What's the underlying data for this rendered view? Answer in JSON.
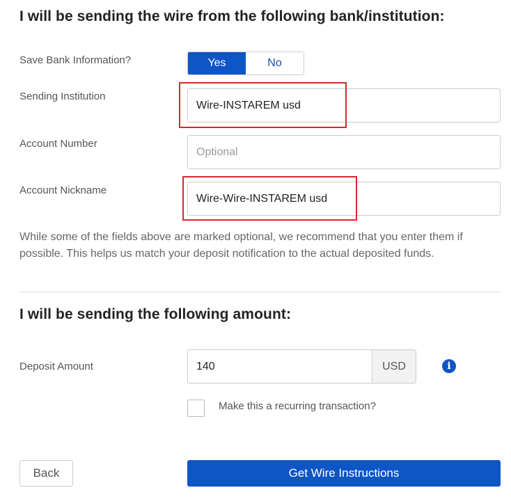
{
  "bank_section": {
    "title": "I will be sending the wire from the following bank/institution:",
    "save_bank_info": {
      "label": "Save Bank Information?",
      "options": [
        "Yes",
        "No"
      ],
      "selected": "Yes"
    },
    "sending_institution": {
      "label": "Sending Institution",
      "value": "Wire-INSTAREM usd"
    },
    "account_number": {
      "label": "Account Number",
      "value": "",
      "placeholder": "Optional"
    },
    "account_nickname": {
      "label": "Account Nickname",
      "value": "Wire-Wire-INSTAREM usd"
    },
    "note": "While some of the fields above are marked optional, we recommend that you enter them if possible. This helps us match your deposit notification to the actual deposited funds."
  },
  "amount_section": {
    "title": "I will be sending the following amount:",
    "deposit_amount": {
      "label": "Deposit Amount",
      "value": "140",
      "currency": "USD",
      "info_icon": "info-circle-icon"
    },
    "recurring": {
      "label": "Make this a recurring transaction?",
      "checked": false
    }
  },
  "actions": {
    "back_label": "Back",
    "submit_label": "Get Wire Instructions"
  },
  "colors": {
    "primary": "#0e55c6",
    "highlight": "#d9262c"
  }
}
